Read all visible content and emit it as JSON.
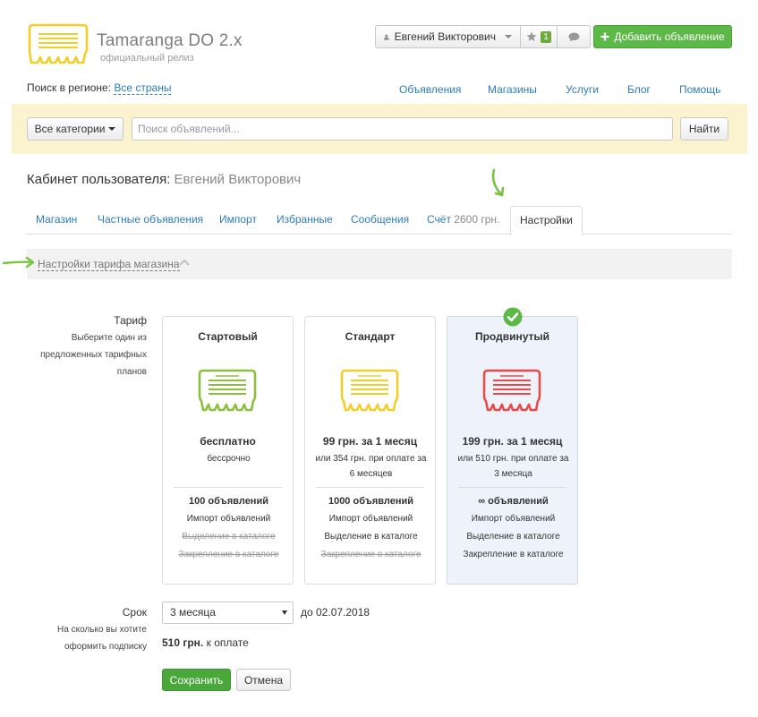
{
  "colors": {
    "brand_yellow": "#f0cf2a",
    "accent_green": "#5cb847",
    "link_blue": "#2c7bbf",
    "plan_start": "#8cbf3d",
    "plan_standard": "#f0cf2a",
    "plan_advanced": "#e84a4a"
  },
  "header": {
    "brand_name": "Tamaranga DO 2.x",
    "brand_sub": "официальный релиз",
    "user_name": "Евгений Викторович",
    "favorites_count": "1",
    "add_button": "Добавить объявление",
    "region_label": "Поиск в регионе:",
    "region_value": "Все страны",
    "nav": [
      "Объявления",
      "Магазины",
      "Услуги",
      "Блог",
      "Помощь"
    ]
  },
  "search": {
    "category_button": "Все категории",
    "placeholder": "Поиск объявлений...",
    "find_button": "Найти"
  },
  "cabinet": {
    "title": "Кабинет пользователя:",
    "user": "Евгений Викторович",
    "tabs": [
      "Магазин",
      "Частные объявления",
      "Импорт",
      "Избранные",
      "Сообщения",
      "Счёт",
      "Настройки"
    ],
    "balance": "2600 грн.",
    "active_tab": "Настройки",
    "section_title": "Настройки тарифа магазина"
  },
  "tariff": {
    "label": "Тариф",
    "hint": "Выберите один из предложенных тарифных планов",
    "selected": "Продвинутый",
    "plans": [
      {
        "name": "Стартовый",
        "logo_color": "#8cbf3d",
        "price": "бесплатно",
        "sub": "бессрочно",
        "ads": "100 объявлений",
        "import": "Импорт объявлений",
        "highlight": "Выделение в каталоге",
        "highlight_included": false,
        "pin": "Закрепление в каталоге",
        "pin_included": false
      },
      {
        "name": "Стандарт",
        "logo_color": "#f0cf2a",
        "price": "99 грн. за 1 месяц",
        "sub": "или 354 грн. при оплате за 6 месяцев",
        "ads": "1000 объявлений",
        "import": "Импорт объявлений",
        "highlight": "Выделение в каталоге",
        "highlight_included": true,
        "pin": "Закрепление в каталоге",
        "pin_included": false
      },
      {
        "name": "Продвинутый",
        "logo_color": "#e84a4a",
        "price": "199 грн. за 1 месяц",
        "sub": "или 510 грн. при оплате за 3 месяца",
        "ads": "∞ объявлений",
        "import": "Импорт объявлений",
        "highlight": "Выделение в каталоге",
        "highlight_included": true,
        "pin": "Закрепление в каталоге",
        "pin_included": true
      }
    ]
  },
  "term": {
    "label": "Срок",
    "hint": "На сколько вы хотите оформить подписку",
    "value": "3 месяца",
    "until": "до 02.07.2018",
    "amount": "510 грн.",
    "amount_suffix": "к оплате",
    "save_button": "Сохранить",
    "cancel_button": "Отмена"
  }
}
